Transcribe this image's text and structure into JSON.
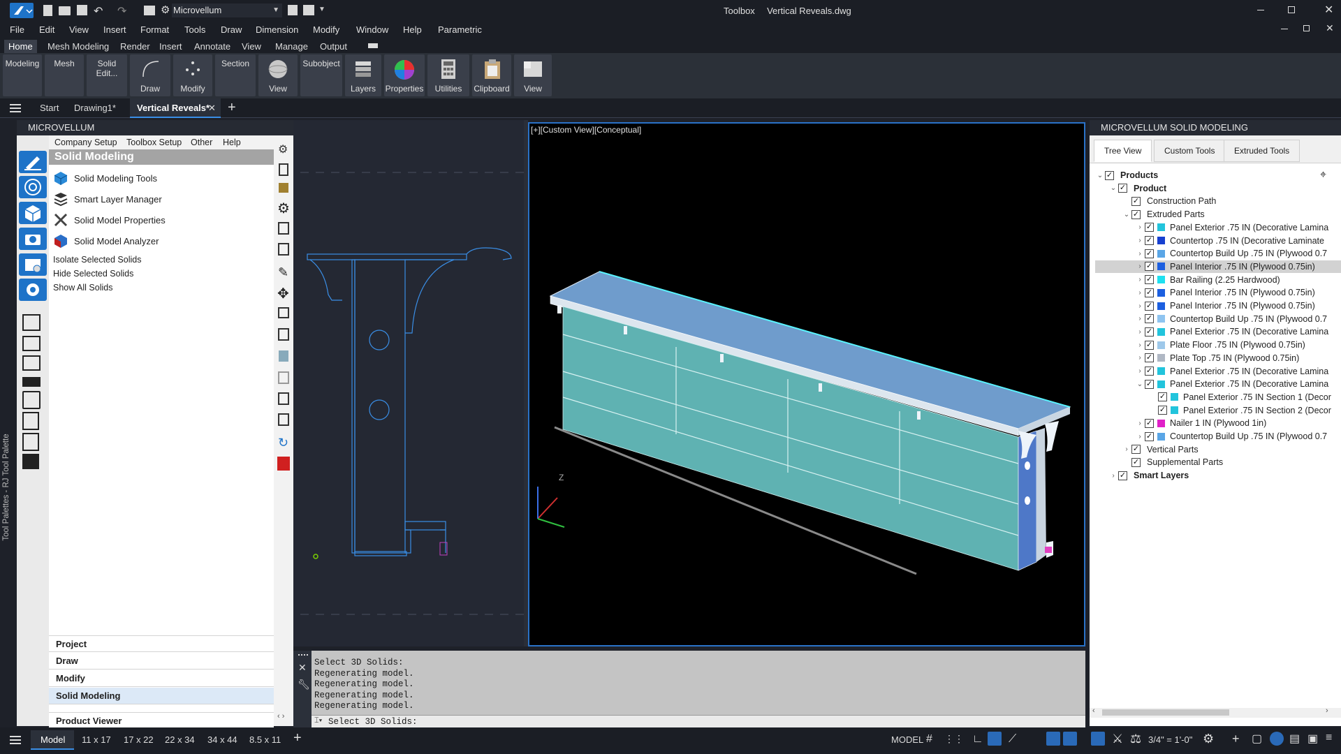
{
  "app": {
    "workspace": "Microvellum",
    "title_prefix": "Toolbox",
    "title_file": "Vertical Reveals.dwg"
  },
  "menu": [
    "File",
    "Edit",
    "View",
    "Insert",
    "Format",
    "Tools",
    "Draw",
    "Dimension",
    "Modify",
    "Window",
    "Help",
    "Parametric"
  ],
  "ribbon_tabs": [
    "Home",
    "Mesh Modeling",
    "Render",
    "Insert",
    "Annotate",
    "View",
    "Manage",
    "Output"
  ],
  "ribbon_buttons": {
    "modeling": "Modeling",
    "mesh": "Mesh",
    "solid_edit": "Solid Edit...",
    "draw": "Draw",
    "modify": "Modify",
    "section": "Section",
    "view": "View",
    "subobject": "Subobject",
    "layers": "Layers",
    "properties": "Properties",
    "utilities": "Utilities",
    "clipboard": "Clipboard",
    "view2": "View"
  },
  "doc_tabs": {
    "start": "Start",
    "drawing1": "Drawing1*",
    "vertical": "Vertical Reveals*"
  },
  "left_panel": {
    "title": "MICROVELLUM",
    "side_label": "Tool Palettes - RJ Tool Palette",
    "menu": [
      "Company Setup",
      "Toolbox Setup",
      "Other",
      "Help"
    ],
    "section_title": "Solid Modeling",
    "tools": [
      "Solid Modeling Tools",
      "Smart Layer Manager",
      "Solid Model Properties",
      "Solid Model Analyzer"
    ],
    "links": [
      "Isolate Selected Solids",
      "Hide Selected Solids",
      "Show All Solids"
    ],
    "categories": [
      "Project",
      "Draw",
      "Modify",
      "Solid Modeling",
      "Product Viewer"
    ]
  },
  "viewport": {
    "label": "[+][Custom View][Conceptual]",
    "axis_z": "Z"
  },
  "command": {
    "lines": [
      "Select 3D Solids:",
      "Regenerating model.",
      "Regenerating model.",
      "Regenerating model.",
      "Regenerating model."
    ],
    "prompt": "Select 3D Solids:"
  },
  "right_panel": {
    "title": "MICROVELLUM SOLID MODELING",
    "tabs": [
      "Tree View",
      "Custom Tools",
      "Extruded Tools"
    ],
    "tree": [
      {
        "label": "Products",
        "bold": true,
        "indent": 0,
        "chev": "v",
        "color": ""
      },
      {
        "label": "Product",
        "bold": true,
        "indent": 1,
        "chev": "v",
        "color": ""
      },
      {
        "label": "Construction Path",
        "bold": false,
        "indent": 2,
        "chev": "",
        "color": ""
      },
      {
        "label": "Extruded Parts",
        "bold": false,
        "indent": 2,
        "chev": "v",
        "color": ""
      },
      {
        "label": "Panel Exterior .75 IN  (Decorative Lamina",
        "bold": false,
        "indent": 3,
        "chev": ">",
        "color": "#22c4dc"
      },
      {
        "label": "Countertop .75 IN  (Decorative Laminate",
        "bold": false,
        "indent": 3,
        "chev": ">",
        "color": "#1740d0"
      },
      {
        "label": "Countertop Build Up .75 IN  (Plywood 0.7",
        "bold": false,
        "indent": 3,
        "chev": ">",
        "color": "#5aa6e6"
      },
      {
        "label": "Panel Interior .75 IN  (Plywood 0.75in)",
        "bold": false,
        "indent": 3,
        "chev": ">",
        "color": "#1c5fe0",
        "selected": true
      },
      {
        "label": "Bar Railing  (2.25 Hardwood)",
        "bold": false,
        "indent": 3,
        "chev": ">",
        "color": "#1ee0f0"
      },
      {
        "label": "Panel Interior .75 IN  (Plywood 0.75in)",
        "bold": false,
        "indent": 3,
        "chev": ">",
        "color": "#1c5fe0"
      },
      {
        "label": "Panel Interior .75 IN  (Plywood 0.75in)",
        "bold": false,
        "indent": 3,
        "chev": ">",
        "color": "#1c5fe0"
      },
      {
        "label": "Countertop Build Up .75 IN  (Plywood 0.7",
        "bold": false,
        "indent": 3,
        "chev": ">",
        "color": "#8fc4f0"
      },
      {
        "label": "Panel Exterior .75 IN  (Decorative Lamina",
        "bold": false,
        "indent": 3,
        "chev": ">",
        "color": "#22c4dc"
      },
      {
        "label": "Plate Floor .75 IN  (Plywood 0.75in)",
        "bold": false,
        "indent": 3,
        "chev": ">",
        "color": "#9ec8ea"
      },
      {
        "label": "Plate Top .75 IN  (Plywood 0.75in)",
        "bold": false,
        "indent": 3,
        "chev": ">",
        "color": "#b0b8c4"
      },
      {
        "label": "Panel Exterior .75 IN  (Decorative Lamina",
        "bold": false,
        "indent": 3,
        "chev": ">",
        "color": "#22c4dc"
      },
      {
        "label": "Panel Exterior .75 IN  (Decorative Lamina",
        "bold": false,
        "indent": 3,
        "chev": "v",
        "color": "#22c4dc"
      },
      {
        "label": "Panel Exterior .75 IN Section 1 (Decor",
        "bold": false,
        "indent": 4,
        "chev": "",
        "color": "#22c4dc"
      },
      {
        "label": "Panel Exterior .75 IN Section 2 (Decor",
        "bold": false,
        "indent": 4,
        "chev": "",
        "color": "#22c4dc"
      },
      {
        "label": "Nailer 1 IN  (Plywood 1in)",
        "bold": false,
        "indent": 3,
        "chev": ">",
        "color": "#e020c8"
      },
      {
        "label": "Countertop Build Up .75 IN  (Plywood 0.7",
        "bold": false,
        "indent": 3,
        "chev": ">",
        "color": "#5aa6e6"
      },
      {
        "label": "Vertical Parts",
        "bold": false,
        "indent": 2,
        "chev": ">",
        "color": ""
      },
      {
        "label": "Supplemental Parts",
        "bold": false,
        "indent": 2,
        "chev": "",
        "color": ""
      },
      {
        "label": "Smart Layers",
        "bold": true,
        "indent": 1,
        "chev": ">",
        "color": ""
      }
    ]
  },
  "status": {
    "layouts": [
      "Model",
      "11 x 17",
      "17 x 22",
      "22 x 34",
      "34 x 44",
      "8.5 x 11"
    ],
    "space": "MODEL",
    "scale": "3/4\" = 1'-0\""
  }
}
